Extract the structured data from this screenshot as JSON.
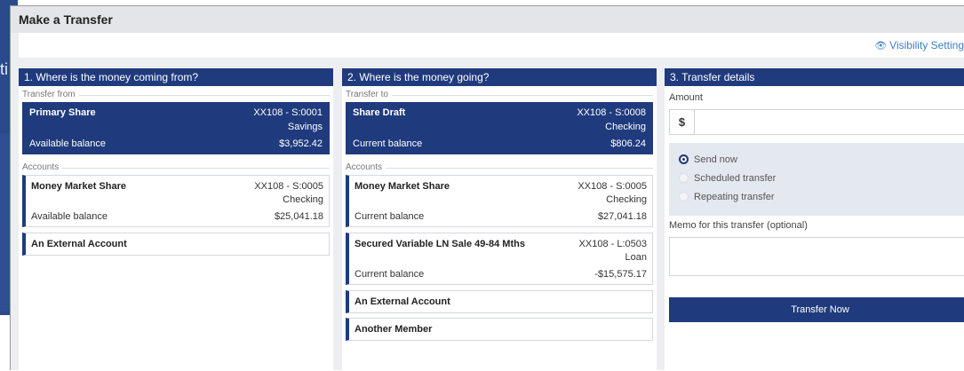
{
  "background": {
    "fragment": "ti"
  },
  "modal": {
    "title": "Make a Transfer",
    "visibility_link": "Visibility Settings",
    "accent_color": "#1f3b7d",
    "link_color": "#3d7fc9"
  },
  "col1": {
    "header": "1. Where is the money coming from?",
    "from_label": "Transfer from",
    "selected": {
      "name": "Primary Share",
      "number": "XX108   - S:0001",
      "type": "Savings",
      "balance_label": "Available balance",
      "balance": "$3,952.42"
    },
    "accounts_label": "Accounts",
    "accounts": [
      {
        "name": "Money Market Share",
        "number": "XX108   - S:0005",
        "type": "Checking",
        "balance_label": "Available balance",
        "balance": "$25,041.18"
      },
      {
        "name": "An External Account"
      }
    ]
  },
  "col2": {
    "header": "2. Where is the money going?",
    "to_label": "Transfer to",
    "selected": {
      "name": "Share Draft",
      "number": "XX108   - S:0008",
      "type": "Checking",
      "balance_label": "Current balance",
      "balance": "$806.24"
    },
    "accounts_label": "Accounts",
    "accounts": [
      {
        "name": "Money Market Share",
        "number": "XX108   - S:0005",
        "type": "Checking",
        "balance_label": "Current balance",
        "balance": "$27,041.18"
      },
      {
        "name": "Secured Variable LN Sale 49-84 Mths",
        "number": "XX108   - L:0503",
        "type": "Loan",
        "balance_label": "Current balance",
        "balance": "-$15,575.17"
      },
      {
        "name": "An External Account"
      },
      {
        "name": "Another Member"
      }
    ]
  },
  "col3": {
    "header": "3. Transfer details",
    "amount_label": "Amount",
    "currency_symbol": "$",
    "amount_value": "",
    "options": [
      {
        "label": "Send now",
        "selected": true
      },
      {
        "label": "Scheduled transfer",
        "selected": false
      },
      {
        "label": "Repeating transfer",
        "selected": false
      }
    ],
    "memo_label": "Memo for this transfer (optional)",
    "memo_value": "",
    "submit_label": "Transfer Now"
  }
}
